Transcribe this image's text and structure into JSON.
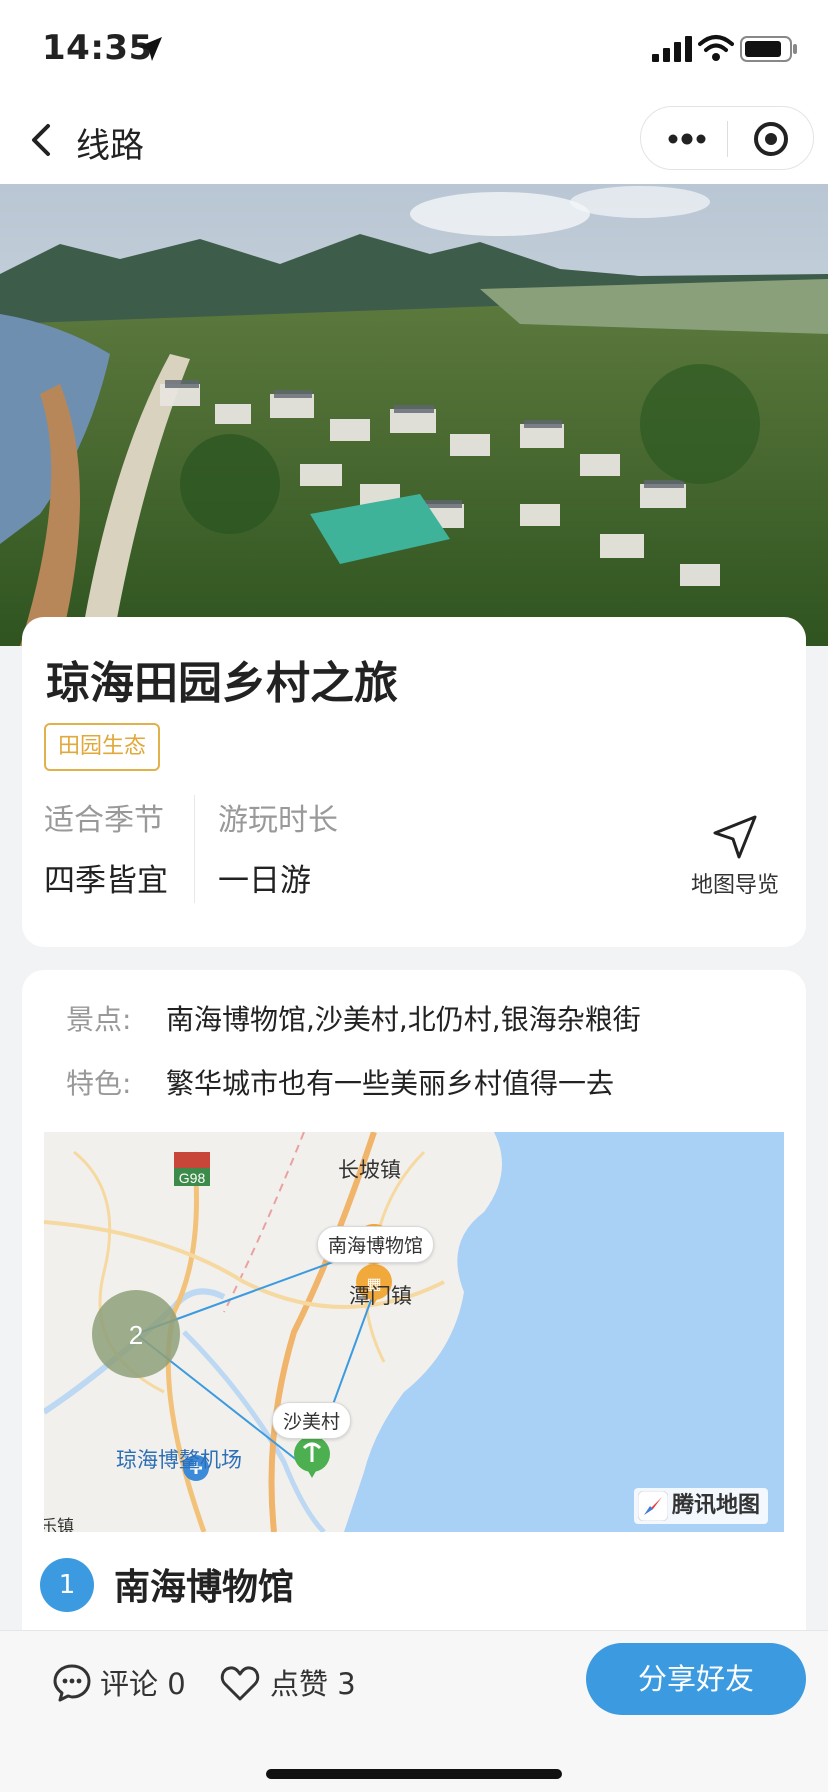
{
  "status_bar": {
    "time": "14:35"
  },
  "nav": {
    "title": "线路"
  },
  "route": {
    "title": "琼海田园乡村之旅",
    "tag": "田园生态",
    "season_label": "适合季节",
    "season_value": "四季皆宜",
    "duration_label": "游玩时长",
    "duration_value": "一日游",
    "map_nav_label": "地图导览"
  },
  "details": {
    "spots_label": "景点:",
    "spots_value": "南海博物馆,沙美村,北仍村,银海杂粮街",
    "feature_label": "特色:",
    "feature_value": "繁华城市也有一些美丽乡村值得一去"
  },
  "map": {
    "highway": "G98",
    "town_north": "长坡镇",
    "town_mid": "潭门镇",
    "airport": "琼海博鳌机场",
    "edge_text": "乐镇",
    "bubble_museum": "南海博物馆",
    "bubble_village": "沙美村",
    "cluster_count": "2",
    "provider": "腾讯地图",
    "water_color": "#a9d0f5",
    "route_color": "#3c9be0",
    "cluster_color": "#8ea07a"
  },
  "stop": {
    "number": "1",
    "title": "南海博物馆"
  },
  "bottom": {
    "comment_label": "评论",
    "comment_count": "0",
    "like_label": "点赞",
    "like_count": "3",
    "share_label": "分享好友"
  },
  "colors": {
    "accent": "#3c9be0",
    "tag": "#e1a83a"
  }
}
